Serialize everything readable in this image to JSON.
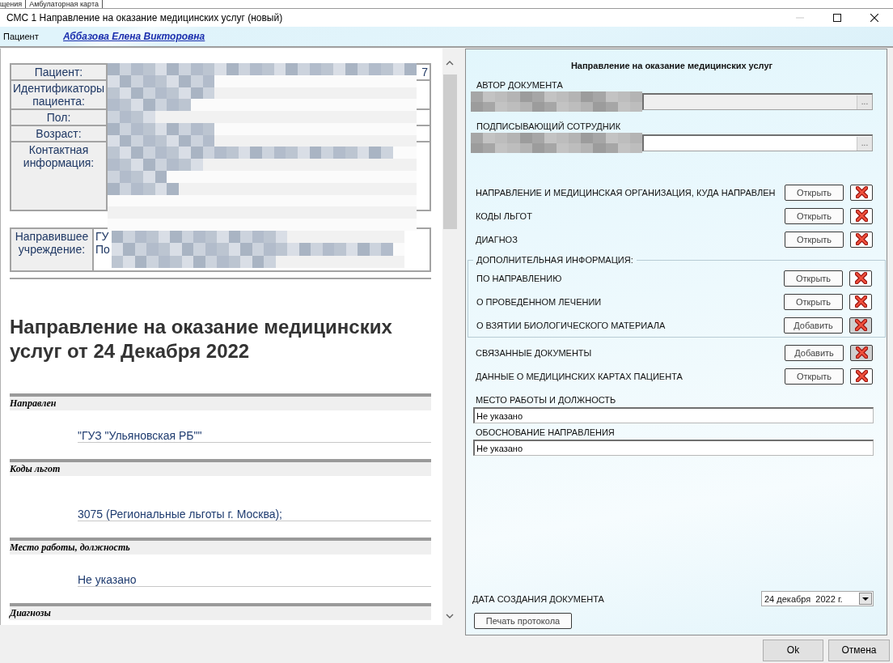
{
  "background_tabs": [
    {
      "label": "щения"
    },
    {
      "label": "Амбулаторная карта"
    }
  ],
  "window": {
    "title": "СМС 1 Направление на оказание медицинских услуг (новый)",
    "controls": [
      {
        "kind": "minimize",
        "disabled": true
      },
      {
        "kind": "maximize",
        "disabled": false
      },
      {
        "kind": "close",
        "disabled": false
      }
    ]
  },
  "patient_bar": {
    "label": "Пациент",
    "name": "Аббазова Елена Викторовна"
  },
  "document": {
    "patient_table": [
      {
        "label": "Пациент:",
        "value": "7"
      },
      {
        "label": "Идентификаторы пациента:"
      },
      {
        "label": "Пол:"
      },
      {
        "label": "Возраст:"
      },
      {
        "label": "Контактная информация:"
      }
    ],
    "institution_table": [
      {
        "label": "Направившее учреждение:",
        "lines": [
          "ГУ",
          "По"
        ]
      }
    ],
    "heading": "Направление на оказание медицинских услуг от 24 Декабря 2022",
    "sections": [
      {
        "title": "Направлен",
        "value": "\"ГУЗ \"Ульяновская РБ\"\""
      },
      {
        "title": "Коды льгот",
        "value": "3075 (Региональные льготы г. Москва);"
      },
      {
        "title": "Место работы, должность",
        "value": "Не указано"
      },
      {
        "title": "Диагнозы"
      }
    ]
  },
  "form": {
    "title": "Направление на оказание медицинских услуг",
    "author": {
      "label": "АВТОР ДОКУМЕНТА",
      "button": "...",
      "disabled": true
    },
    "signer": {
      "label": "ПОДПИСЫВАЮЩИЙ СОТРУДНИК",
      "button": "...",
      "disabled": false
    },
    "rows": [
      {
        "label": "НАПРАВЛЕНИЕ И МЕДИЦИНСКАЯ ОРГАНИЗАЦИЯ, КУДА НАПРАВЛЕН",
        "action": "Открыть",
        "delete_disabled": false
      },
      {
        "label": "КОДЫ ЛЬГОТ",
        "action": "Открыть",
        "delete_disabled": false
      },
      {
        "label": "ДИАГНОЗ",
        "action": "Открыть",
        "delete_disabled": false
      }
    ],
    "group": {
      "legend": "ДОПОЛНИТЕЛЬНАЯ ИНФОРМАЦИЯ:",
      "rows": [
        {
          "label": "ПО НАПРАВЛЕНИЮ",
          "action": "Открыть",
          "delete_disabled": false
        },
        {
          "label": "О ПРОВЕДЁННОМ ЛЕЧЕНИИ",
          "action": "Открыть",
          "delete_disabled": false
        },
        {
          "label": "О ВЗЯТИИ БИОЛОГИЧЕСКОГО МАТЕРИАЛА",
          "action": "Добавить",
          "delete_disabled": true
        }
      ]
    },
    "rows_after": [
      {
        "label": "СВЯЗАННЫЕ ДОКУМЕНТЫ",
        "action": "Добавить",
        "delete_disabled": true
      },
      {
        "label": "ДАННЫЕ О МЕДИЦИНСКИХ КАРТАХ ПАЦИЕНТА",
        "action": "Открыть",
        "delete_disabled": false
      }
    ],
    "fields": [
      {
        "label": "МЕСТО РАБОТЫ И ДОЛЖНОСТЬ",
        "value": "Не указано"
      },
      {
        "label": "ОБОСНОВАНИЕ НАПРАВЛЕНИЯ",
        "value": "Не указано"
      }
    ],
    "date": {
      "label": "ДАТА СОЗДАНИЯ ДОКУМЕНТА",
      "value": "24 декабря  2022 г."
    },
    "print_button": "Печать протокола"
  },
  "buttons": [
    "Ok",
    "Отмена"
  ]
}
